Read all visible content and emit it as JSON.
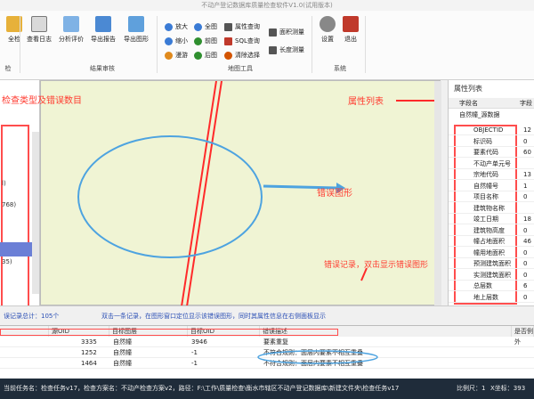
{
  "window": {
    "title": "不动产登记数据库质量检查软件V1.0(试用版本)"
  },
  "ribbon": {
    "buttons_left": [
      "全检",
      "查看日志",
      "分析评价",
      "导出报告",
      "导出图形"
    ],
    "group_check_label": "检",
    "group_results_label": "结果审核",
    "map_tools": {
      "col1": [
        "放大",
        "缩小",
        "漫游"
      ],
      "col2": [
        "全图",
        "前图",
        "后图"
      ],
      "col3": [
        "属性查询",
        "SQL查询",
        "清除选择"
      ],
      "col4": [
        "面积测量",
        "长度测量"
      ]
    },
    "group_map_label": "地图工具",
    "buttons_system": [
      "设置",
      "退出"
    ],
    "group_system_label": "系统"
  },
  "annotations": {
    "check_types": "检查类型及错误数目",
    "property_list": "属性列表",
    "error_graphic": "错误图形",
    "error_records": "错误记录，双击显示错误图形"
  },
  "left_panel": {
    "items": [
      "l)",
      "768)",
      "35)"
    ]
  },
  "right_panel": {
    "title": "属性列表",
    "header_field": "字段名",
    "header_value": "字段",
    "group": "自然幢_源数据",
    "rows": [
      {
        "k": "OBJECTID",
        "v": "12"
      },
      {
        "k": "标识码",
        "v": "0"
      },
      {
        "k": "要素代码",
        "v": "60"
      },
      {
        "k": "不动产单元号",
        "v": ""
      },
      {
        "k": "宗地代码",
        "v": "13"
      },
      {
        "k": "自然幢号",
        "v": "1"
      },
      {
        "k": "项目名称",
        "v": "0"
      },
      {
        "k": "建筑物名称",
        "v": ""
      },
      {
        "k": "竣工日期",
        "v": "18"
      },
      {
        "k": "建筑物高度",
        "v": "0"
      },
      {
        "k": "幢占地面积",
        "v": "46"
      },
      {
        "k": "幢用地面积",
        "v": "0"
      },
      {
        "k": "预测建筑面积",
        "v": "0"
      },
      {
        "k": "实测建筑面积",
        "v": "0"
      },
      {
        "k": "总层数",
        "v": "6"
      },
      {
        "k": "地上层数",
        "v": "0"
      }
    ]
  },
  "summary": {
    "total": "误记录总计：105个",
    "hint": "双击一条记录，在图形窗口定位显示该错误图形，同时其属性信息在右侧面板显示"
  },
  "table": {
    "headers": [
      "",
      "源OID",
      "目标图层",
      "目标OID",
      "错误描述",
      "是否例外"
    ],
    "rows": [
      [
        "",
        "3335",
        "自然幢",
        "3946",
        "要素重复",
        ""
      ],
      [
        "",
        "1252",
        "自然幢",
        "-1",
        "不符合规则：面层内要素不相互重叠",
        ""
      ],
      [
        "",
        "1464",
        "自然幢",
        "-1",
        "不符合规则：面层内要素不相互重叠",
        ""
      ]
    ]
  },
  "status": {
    "text": "当前任务名：检查任务v17，检查方案名：不动产检查方案v2，路径：F:\\工作\\质量检查\\衡水市辖区不动产登记数据库\\新建文件夹\\检查任务v17",
    "scale": "比例尺：1",
    "x": "X坐标：393"
  },
  "colors": {
    "accent": "#ff3b30",
    "ellipse": "#4da3e0",
    "status_bg": "#1f2c3a"
  }
}
